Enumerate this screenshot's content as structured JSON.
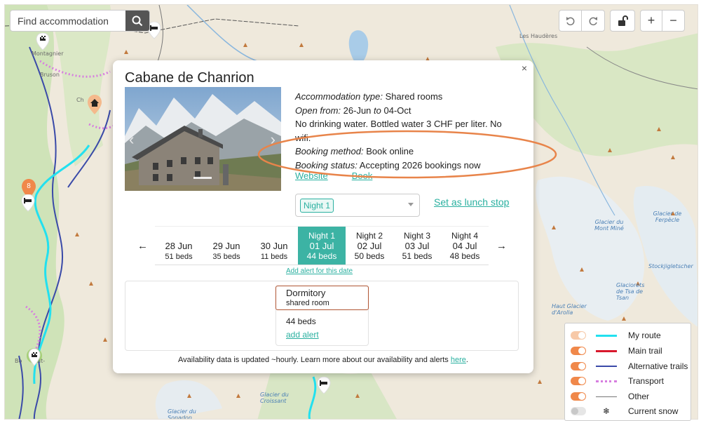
{
  "search": {
    "placeholder": "Find accommodation"
  },
  "map_controls": {
    "undo_icon": "undo-icon",
    "redo_icon": "redo-icon",
    "lock_icon": "unlock-icon",
    "zoom_in": "+",
    "zoom_out": "−"
  },
  "map_labels": {
    "montagnier": "Montagnier",
    "bruson": "Bruson",
    "ch": "Ch",
    "les_hauderes": "Les Haudères",
    "bo": "Bo",
    "nt": "nt-",
    "glacier_mont_mine": "Glacier du Mont Miné",
    "glacier_ferpecle": "Glacier de Ferpècle",
    "stockjigletscher": "Stockjigletscher",
    "glaciorets": "Glaciorets de Tsa de Tsan",
    "haut_glacier": "Haut Glacier d'Arolla",
    "glacier_croissant": "Glacier du Croissant",
    "glacier_sonadon": "Glacier du Sonadon",
    "marker_count": "8"
  },
  "popup": {
    "title": "Cabane de Chanrion",
    "close": "×",
    "accommodation_type_label": "Accommodation type:",
    "accommodation_type": "Shared rooms",
    "open_from_label": "Open from:",
    "open_from": "26-Jun",
    "open_to_word": "to",
    "open_to": "04-Oct",
    "notes": "No drinking water. Bottled water 3 CHF per liter. No wifi.",
    "booking_method_label": "Booking method:",
    "booking_method": "Book online",
    "booking_status_label": "Booking status:",
    "booking_status": "Accepting 2026 bookings now",
    "website_link": "Website",
    "book_link": "Book",
    "night_select_value": "Night 1",
    "lunch_stop_link": "Set as lunch stop",
    "add_alert_date": "Add alert for this date",
    "calendar": [
      {
        "date": "28 Jun",
        "beds": "51 beds"
      },
      {
        "date": "29 Jun",
        "beds": "35 beds"
      },
      {
        "date": "30 Jun",
        "beds": "11 beds"
      },
      {
        "night": "Night 1",
        "date": "01 Jul",
        "beds": "44 beds"
      },
      {
        "night": "Night 2",
        "date": "02 Jul",
        "beds": "50 beds"
      },
      {
        "night": "Night 3",
        "date": "03 Jul",
        "beds": "51 beds"
      },
      {
        "night": "Night 4",
        "date": "04 Jul",
        "beds": "48 beds"
      }
    ],
    "room": {
      "name": "Dormitory",
      "type": "shared room",
      "beds": "44 beds",
      "add_alert": "add alert"
    },
    "footer_text": "Availability data is updated ~hourly. Learn more about our availability and alerts",
    "footer_link": "here",
    "footer_end": "."
  },
  "legend": [
    {
      "label": "My route",
      "toggle": "light",
      "swatch": "route"
    },
    {
      "label": "Main trail",
      "toggle": "on",
      "swatch": "main"
    },
    {
      "label": "Alternative trails",
      "toggle": "on",
      "swatch": "alt"
    },
    {
      "label": "Transport",
      "toggle": "on",
      "swatch": "transport"
    },
    {
      "label": "Other",
      "toggle": "on",
      "swatch": "other"
    },
    {
      "label": "Current snow",
      "toggle": "off",
      "swatch": "snow"
    }
  ],
  "colors": {
    "accent": "#3cb3a4",
    "route": "#22e0ef",
    "main_trail": "#d8182c",
    "alt_trail": "#3a4aa8",
    "transport": "#d77ee0",
    "toggle_on": "#f0884a",
    "highlight_oval": "#e8844a",
    "room_border": "#b05533"
  }
}
